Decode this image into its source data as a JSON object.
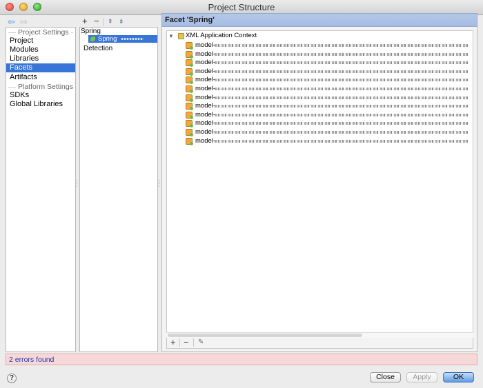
{
  "window": {
    "title": "Project Structure"
  },
  "nav": {
    "back_icon": "arrow-left-icon",
    "forward_icon": "arrow-right-icon"
  },
  "sidebar": {
    "project_settings_title": "Project Settings",
    "project_items": [
      {
        "label": "Project",
        "selected": false
      },
      {
        "label": "Modules",
        "selected": false
      },
      {
        "label": "Libraries",
        "selected": false
      },
      {
        "label": "Facets",
        "selected": true
      },
      {
        "label": "Artifacts",
        "selected": false
      }
    ],
    "platform_settings_title": "Platform Settings",
    "platform_items": [
      {
        "label": "SDKs"
      },
      {
        "label": "Global Libraries"
      }
    ]
  },
  "facets_list": {
    "toolbar": {
      "add": "+",
      "remove": "−",
      "expand": "⇞",
      "collapse": "⇟"
    },
    "group": "Spring",
    "selected_item": "Spring",
    "detection": "Detection"
  },
  "facet_panel": {
    "header": "Facet 'Spring'",
    "root_label": "XML Application Context",
    "entries": [
      {
        "label": "model-"
      },
      {
        "label": "model-"
      },
      {
        "label": "model-"
      },
      {
        "label": "model-"
      },
      {
        "label": "model-"
      },
      {
        "label": "model-"
      },
      {
        "label": "model-"
      },
      {
        "label": "model-"
      },
      {
        "label": "model-"
      },
      {
        "label": "model-"
      },
      {
        "label": "model-"
      },
      {
        "label": "model-"
      }
    ],
    "toolbar": {
      "add": "+",
      "remove": "−",
      "edit": "✎"
    }
  },
  "status": {
    "error_text": "2 errors found",
    "error_bg": "#f7d8d8",
    "link_color": "#2233aa"
  },
  "buttons": {
    "help": "?",
    "close": "Close",
    "apply": "Apply",
    "ok": "OK"
  },
  "colors": {
    "selection": "#3875d7",
    "header_blue": "#a6bde2"
  }
}
